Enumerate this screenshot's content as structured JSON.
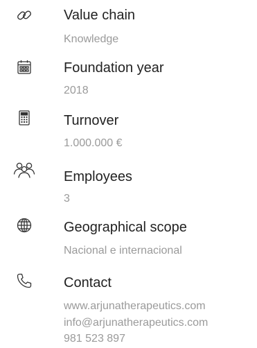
{
  "items": [
    {
      "icon": "link-icon",
      "title": "Value chain",
      "value": "Knowledge"
    },
    {
      "icon": "calendar-icon",
      "title": "Foundation year",
      "value": "2018"
    },
    {
      "icon": "calculator-icon",
      "title": "Turnover",
      "value": "1.000.000 €"
    },
    {
      "icon": "people-icon",
      "title": "Employees",
      "value": "3"
    },
    {
      "icon": "globe-icon",
      "title": "Geographical scope",
      "value": "Nacional e internacional"
    },
    {
      "icon": "phone-icon",
      "title": "Contact",
      "website": "www.arjunatherapeutics.com",
      "email": "info@arjunatherapeutics.com",
      "phone": "981 523 897"
    }
  ]
}
